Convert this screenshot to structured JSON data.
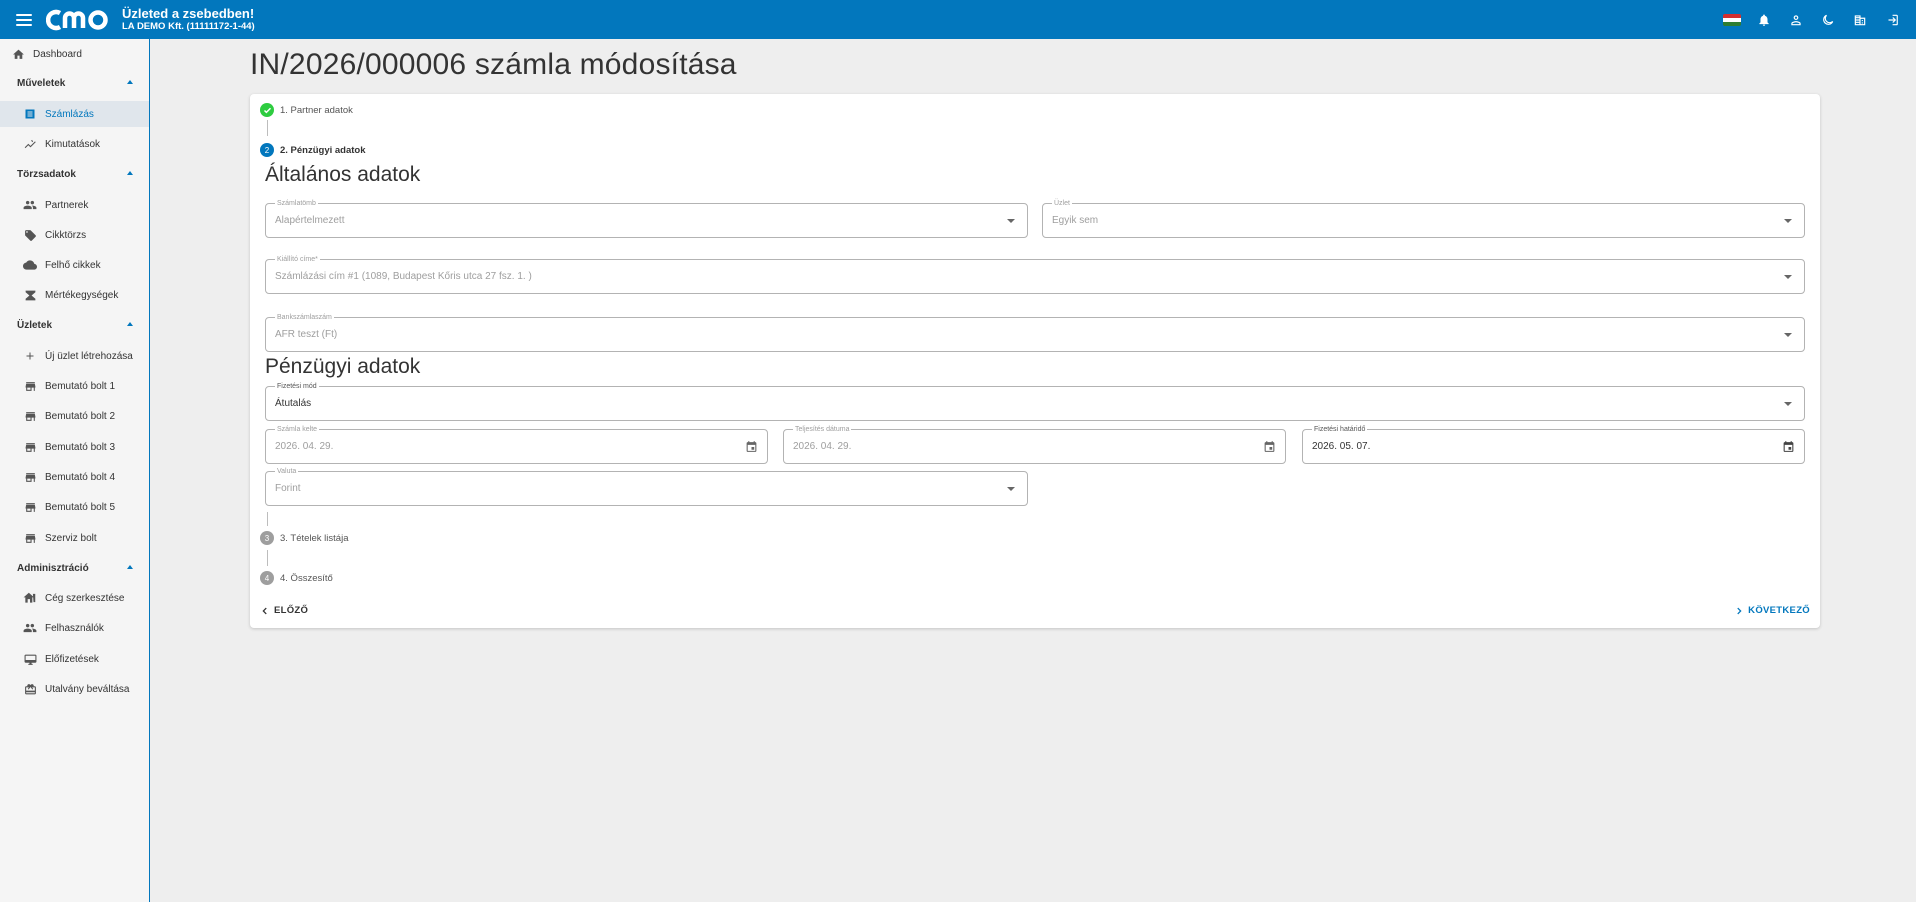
{
  "header": {
    "logo_text": "cmo",
    "brand_title": "Üzleted a zsebedben!",
    "company": "LA DEMO Kft. (11111172-1-44)",
    "icons": [
      "hungarian-flag-icon",
      "bell-icon",
      "user-icon",
      "moon-icon",
      "company-icon",
      "logout-icon"
    ]
  },
  "sidebar": {
    "dashboard": "Dashboard",
    "sections": {
      "muveletek": "Műveletek",
      "torzsadatok": "Törzsadatok",
      "uzletek": "Üzletek",
      "adminisztracio": "Adminisztráció"
    },
    "items": {
      "szamlazas": "Számlázás",
      "kimutatasok": "Kimutatások",
      "partnerek": "Partnerek",
      "cikktorzs": "Cikktörzs",
      "felho_cikkek": "Felhő cikkek",
      "mertekegysegek": "Mértékegységek",
      "uj_uzlet": "Új üzlet létrehozása",
      "bolt1": "Bemutató bolt 1",
      "bolt2": "Bemutató bolt 2",
      "bolt3": "Bemutató bolt 3",
      "bolt4": "Bemutató bolt 4",
      "bolt5": "Bemutató bolt 5",
      "szerviz": "Szerviz bolt",
      "ceg": "Cég szerkesztése",
      "felhasznalok": "Felhasználók",
      "elofizetesek": "Előfizetések",
      "utalvany": "Utalvány beváltása"
    }
  },
  "page": {
    "title": "IN/2026/000006 számla módosítása"
  },
  "stepper": {
    "step1": "1. Partner adatok",
    "step2_num": "2",
    "step2": "2. Pénzügyi adatok",
    "step3_num": "3",
    "step3": "3. Tételek listája",
    "step4_num": "4",
    "step4": "4. Összesítő"
  },
  "general": {
    "title": "Általános adatok",
    "szamlatomb_label": "Számlatömb",
    "szamlatomb_value": "Alapértelmezett",
    "uzlet_label": "Üzlet",
    "uzlet_value": "Egyik sem",
    "kiallito_label": "Kiállító címe*",
    "kiallito_value": "Számlázási cím #1 (1089, Budapest Kőris utca 27 fsz. 1. )",
    "bank_label": "Bankszámlaszám",
    "bank_value": "AFR teszt (Ft)"
  },
  "financial": {
    "title": "Pénzügyi adatok",
    "fizetesi_mod_label": "Fizetési mód",
    "fizetesi_mod_value": "Átutalás",
    "kelte_label": "Számla kelte",
    "kelte_value": "2026. 04. 29.",
    "teljesites_label": "Teljesítés dátuma",
    "teljesites_value": "2026. 04. 29.",
    "hatarido_label": "Fizetési határidő",
    "hatarido_value": "2026. 05. 07.",
    "valuta_label": "Valuta",
    "valuta_value": "Forint"
  },
  "actions": {
    "prev": "ELŐZŐ",
    "next": "KÖVETKEZŐ"
  },
  "colors": {
    "primary": "#0277bd",
    "success": "#2ecc40",
    "disabled_step": "#9e9e9e"
  }
}
